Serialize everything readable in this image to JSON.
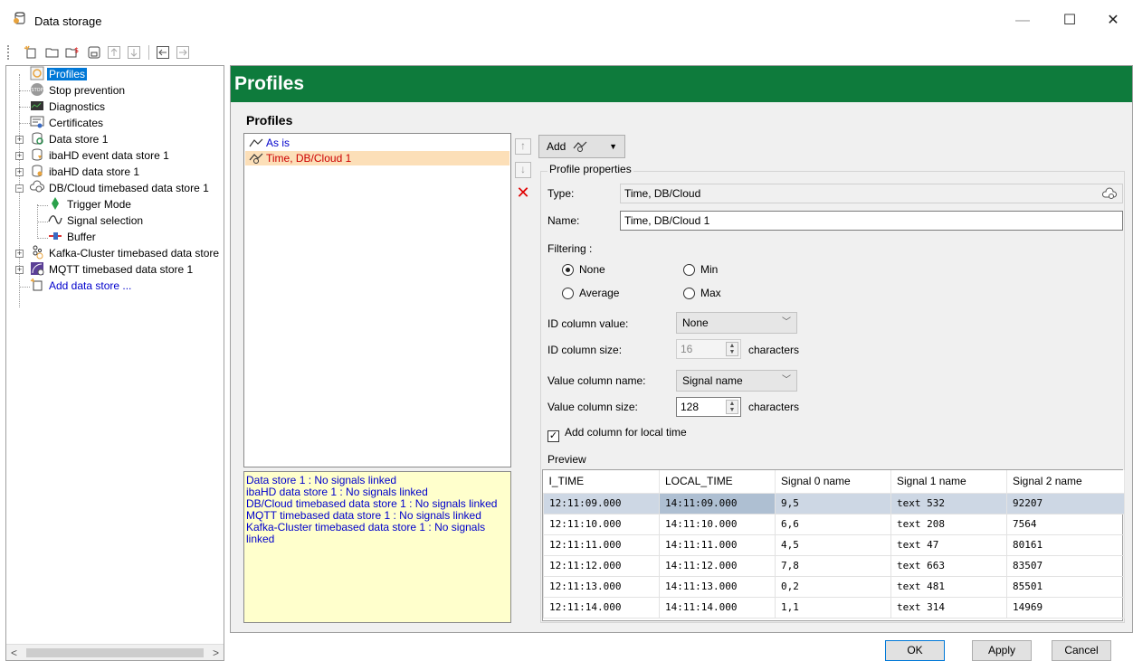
{
  "window": {
    "title": "Data storage",
    "minimize": "—",
    "maximize": "☐",
    "close": "✕"
  },
  "toolbar": {
    "icons": [
      "new-data-store-icon",
      "open-folder-icon",
      "export-icon",
      "save-icon",
      "move-up-icon",
      "move-down-icon",
      "collapse-icon",
      "expand-icon"
    ]
  },
  "tree": {
    "items": [
      {
        "label": "Profiles",
        "icon": "profiles-icon",
        "selected": true
      },
      {
        "label": "Stop prevention",
        "icon": "stop-icon"
      },
      {
        "label": "Diagnostics",
        "icon": "diagnostics-icon"
      },
      {
        "label": "Certificates",
        "icon": "certificates-icon"
      },
      {
        "label": "Data store 1",
        "icon": "data-store-icon"
      },
      {
        "label": "ibaHD event data store 1",
        "icon": "event-store-icon"
      },
      {
        "label": "ibaHD data store 1",
        "icon": "hd-store-icon"
      },
      {
        "label": "DB/Cloud timebased data store 1",
        "icon": "cloud-store-icon"
      },
      {
        "label": "Trigger Mode",
        "icon": "trigger-icon"
      },
      {
        "label": "Signal selection",
        "icon": "signal-icon"
      },
      {
        "label": "Buffer",
        "icon": "buffer-icon"
      },
      {
        "label": "Kafka-Cluster timebased data store",
        "icon": "kafka-icon"
      },
      {
        "label": "MQTT timebased data store 1",
        "icon": "mqtt-icon"
      },
      {
        "label": "Add data store ...",
        "icon": "add-store-icon",
        "link": true
      }
    ],
    "scroll_left": "<",
    "scroll_right": ">"
  },
  "header": {
    "title": "Profiles"
  },
  "main": {
    "section_title": "Profiles",
    "profiles": [
      "As is",
      "Time, DB/Cloud 1"
    ],
    "status_lines": [
      "Data store 1 : No signals linked",
      "ibaHD data store 1 : No signals linked",
      "DB/Cloud timebased data store 1 : No signals linked",
      "MQTT timebased data store 1 : No signals linked",
      "Kafka-Cluster timebased data store 1 : No signals linked"
    ],
    "side_buttons": {
      "up": "↑",
      "down": "↓",
      "delete": "✕"
    },
    "add_button": "Add",
    "add_caret": "▼"
  },
  "properties": {
    "group_label": "Profile properties",
    "type_label": "Type:",
    "type_value": "Time, DB/Cloud",
    "name_label": "Name:",
    "name_value": "Time, DB/Cloud 1",
    "filtering_label": "Filtering :",
    "filter_options": {
      "none": "None",
      "min": "Min",
      "average": "Average",
      "max": "Max"
    },
    "filter_selected": "None",
    "id_column_value_label": "ID column value:",
    "id_column_value": "None",
    "id_column_size_label": "ID column size:",
    "id_column_size": "16",
    "characters": "characters",
    "value_column_name_label": "Value column name:",
    "value_column_name": "Signal name",
    "value_column_size_label": "Value column size:",
    "value_column_size": "128",
    "local_time_label": "Add column for local time",
    "local_time_checked": true,
    "check_mark": "✓",
    "chevron": "﹀",
    "spin_up": "▲",
    "spin_down": "▼"
  },
  "preview": {
    "label": "Preview",
    "columns": [
      "I_TIME",
      "LOCAL_TIME",
      "Signal 0 name",
      "Signal 1 name",
      "Signal 2 name"
    ],
    "rows": [
      [
        "12:11:09.000",
        "14:11:09.000",
        "9,5",
        "text 532",
        "92207"
      ],
      [
        "12:11:10.000",
        "14:11:10.000",
        "6,6",
        "text 208",
        "7564"
      ],
      [
        "12:11:11.000",
        "14:11:11.000",
        "4,5",
        "text 47",
        "80161"
      ],
      [
        "12:11:12.000",
        "14:11:12.000",
        "7,8",
        "text 663",
        "83507"
      ],
      [
        "12:11:13.000",
        "14:11:13.000",
        "0,2",
        "text 481",
        "85501"
      ],
      [
        "12:11:14.000",
        "14:11:14.000",
        "1,1",
        "text 314",
        "14969"
      ]
    ]
  },
  "footer": {
    "ok": "OK",
    "apply": "Apply",
    "cancel": "Cancel"
  },
  "colors": {
    "header_green": "#0e7b3c",
    "selection_blue": "#0078d7",
    "link_blue": "#0000cc",
    "active_profile_red": "#cc0000",
    "active_profile_bg": "#fcdfb8",
    "status_bg": "#ffffcc"
  }
}
